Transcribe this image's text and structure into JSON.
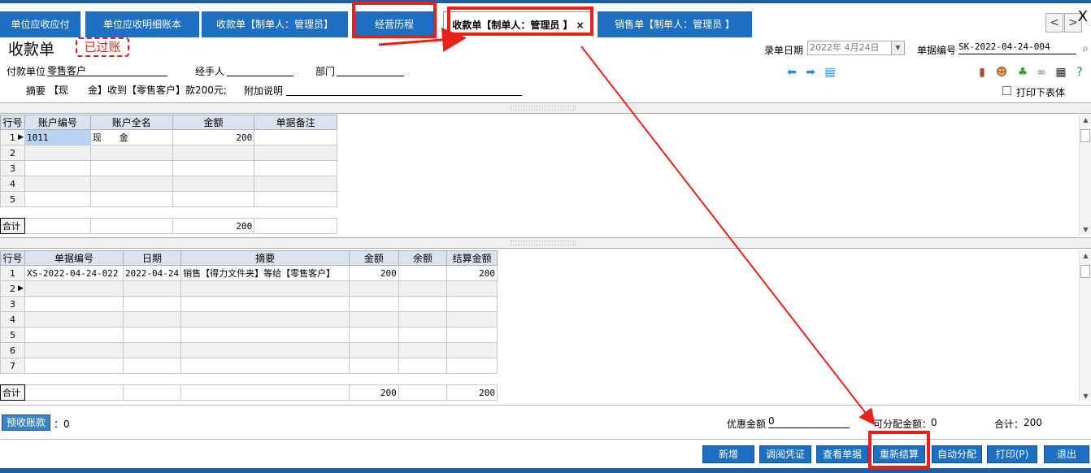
{
  "tabs": [
    {
      "label": "单位应收应付"
    },
    {
      "label": "单位应收明细账本"
    },
    {
      "label": "收款单【制单人：管理员】"
    },
    {
      "label": "经营历程"
    },
    {
      "label": "收款单【制单人：管理员 】",
      "close": "×"
    },
    {
      "label": "销售单【制单人：管理员 】"
    }
  ],
  "window": {
    "close_glyph": "X",
    "prev_glyph": "<",
    "next_glyph": ">"
  },
  "header": {
    "title": "收款单",
    "stamp": "已过账",
    "payer_label": "付款单位",
    "payer_value": "零售客户",
    "handler_label": "经手人",
    "handler_value": "",
    "dept_label": "部门",
    "dept_value": "",
    "summary_label": "摘要",
    "summary_value": "【现　　金】收到【零售客户】款200元;",
    "note_label": "附加说明",
    "note_value": "",
    "date_label": "录单日期",
    "date_value": "2022年 4月24日",
    "docno_label": "单据编号",
    "docno_value": "SK-2022-04-24-004",
    "print_lower_label": "打印下表体"
  },
  "top_grid": {
    "columns": [
      "行号",
      "账户编号",
      "账户全名",
      "金额",
      "单据备注"
    ],
    "rows": [
      {
        "n": "1",
        "code": "1011",
        "name": "现　　金",
        "amount": "200",
        "note": ""
      },
      {
        "n": "2",
        "code": "",
        "name": "",
        "amount": "",
        "note": ""
      },
      {
        "n": "3",
        "code": "",
        "name": "",
        "amount": "",
        "note": ""
      },
      {
        "n": "4",
        "code": "",
        "name": "",
        "amount": "",
        "note": ""
      },
      {
        "n": "5",
        "code": "",
        "name": "",
        "amount": "",
        "note": ""
      }
    ],
    "total_label": "合计",
    "total_amount": "200"
  },
  "bottom_grid": {
    "columns": [
      "行号",
      "单据编号",
      "日期",
      "摘要",
      "金额",
      "余额",
      "结算金额"
    ],
    "rows": [
      {
        "n": "1",
        "docno": "XS-2022-04-24-022",
        "date": "2022-04-24",
        "summary": "销售【得力文件夹】等给【零售客户】",
        "amount": "200",
        "balance": "",
        "settle": "200"
      },
      {
        "n": "2",
        "docno": "",
        "date": "",
        "summary": "",
        "amount": "",
        "balance": "",
        "settle": ""
      },
      {
        "n": "3",
        "docno": "",
        "date": "",
        "summary": "",
        "amount": "",
        "balance": "",
        "settle": ""
      },
      {
        "n": "4",
        "docno": "",
        "date": "",
        "summary": "",
        "amount": "",
        "balance": "",
        "settle": ""
      },
      {
        "n": "5",
        "docno": "",
        "date": "",
        "summary": "",
        "amount": "",
        "balance": "",
        "settle": ""
      },
      {
        "n": "6",
        "docno": "",
        "date": "",
        "summary": "",
        "amount": "",
        "balance": "",
        "settle": ""
      },
      {
        "n": "7",
        "docno": "",
        "date": "",
        "summary": "",
        "amount": "",
        "balance": "",
        "settle": ""
      }
    ],
    "total_label": "合计",
    "total_amount": "200",
    "total_settle": "200"
  },
  "footer": {
    "prepay_button": "预收账款",
    "prepay_value": "：0",
    "discount_label": "优惠金额",
    "discount_value": "0",
    "allocatable_label": "可分配金额：",
    "allocatable_value": "0",
    "total_label": "合计：",
    "total_value": "200"
  },
  "buttons": [
    "新增",
    "调阅凭证",
    "查看单据",
    "重新结算",
    "自动分配",
    "打印(P)",
    "退出"
  ],
  "icons": [
    "left-arrow-icon",
    "right-arrow-icon",
    "document-icon",
    "door-icon",
    "user-icon",
    "leaf-icon",
    "link-icon",
    "qrcode-icon",
    "help-icon",
    "search-icon"
  ],
  "colors": {
    "tab_blue": "#1d6fc2",
    "annotation_red": "#e8211d",
    "stamp_red": "#d22222"
  }
}
